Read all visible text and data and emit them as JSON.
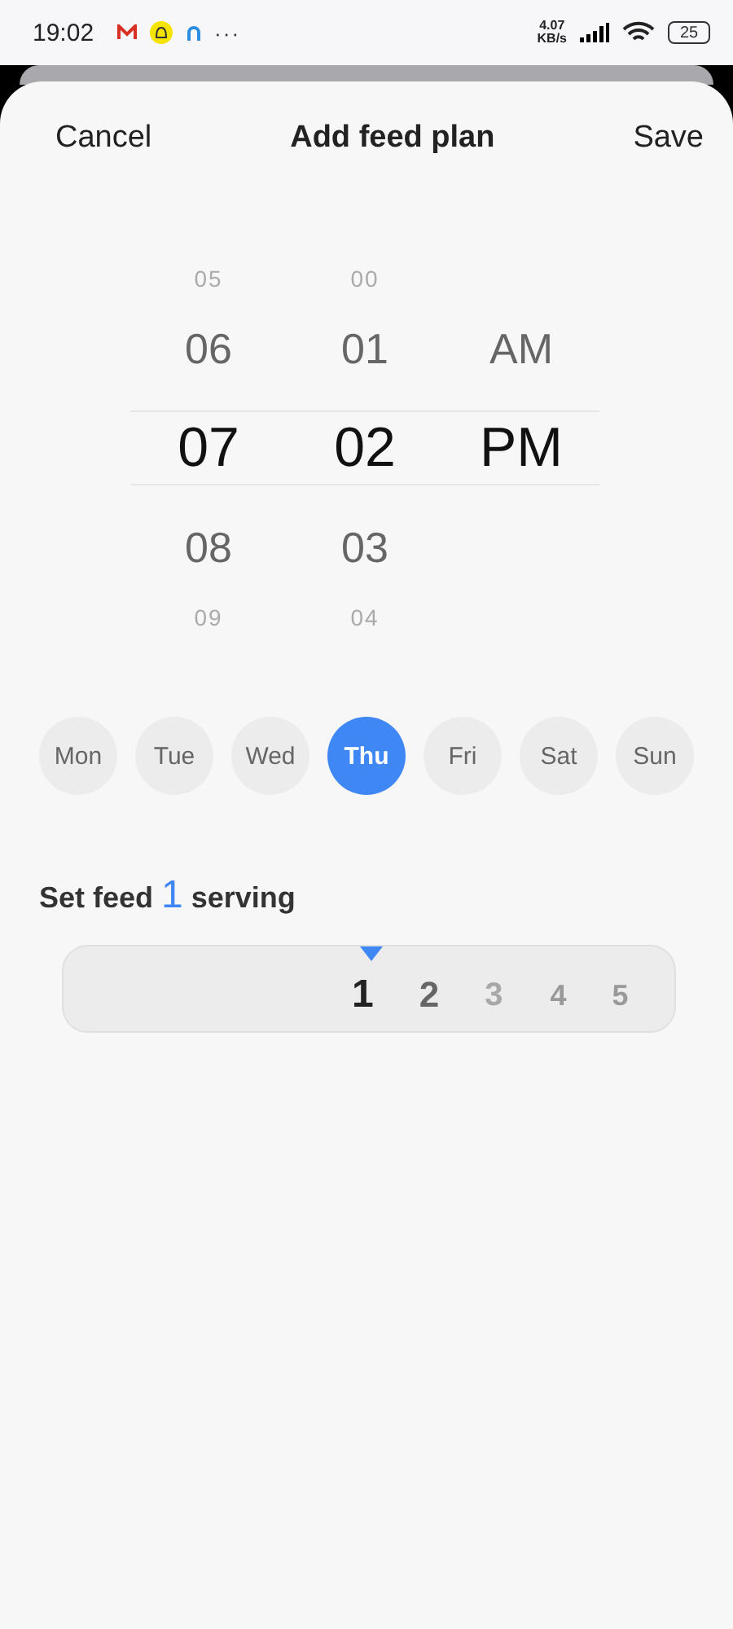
{
  "status_bar": {
    "time": "19:02",
    "more": "···",
    "net_speed_value": "4.07",
    "net_speed_unit": "KB/s",
    "battery": "25"
  },
  "header": {
    "cancel": "Cancel",
    "title": "Add feed plan",
    "save": "Save"
  },
  "time_picker": {
    "columns": [
      {
        "items": [
          {
            "label": "05",
            "selected": false
          },
          {
            "label": "06",
            "selected": false
          },
          {
            "label": "07",
            "selected": true
          },
          {
            "label": "08",
            "selected": false
          },
          {
            "label": "09",
            "selected": false
          }
        ]
      },
      {
        "items": [
          {
            "label": "00",
            "selected": false
          },
          {
            "label": "01",
            "selected": false
          },
          {
            "label": "02",
            "selected": true
          },
          {
            "label": "03",
            "selected": false
          },
          {
            "label": "04",
            "selected": false
          }
        ]
      },
      {
        "items": [
          {
            "label": "AM",
            "selected": false
          },
          {
            "label": "PM",
            "selected": true
          }
        ]
      }
    ]
  },
  "days": [
    {
      "label": "Mon",
      "selected": false
    },
    {
      "label": "Tue",
      "selected": false
    },
    {
      "label": "Wed",
      "selected": false
    },
    {
      "label": "Thu",
      "selected": true
    },
    {
      "label": "Fri",
      "selected": false
    },
    {
      "label": "Sat",
      "selected": false
    },
    {
      "label": "Sun",
      "selected": false
    }
  ],
  "serving": {
    "label_before": "Set feed",
    "value": "1",
    "label_after": "serving"
  },
  "ruler": [
    {
      "label": "1",
      "selected": true
    },
    {
      "label": "2",
      "selected": false
    },
    {
      "label": "3",
      "selected": false
    },
    {
      "label": "4",
      "selected": false
    },
    {
      "label": "5",
      "selected": false
    }
  ]
}
